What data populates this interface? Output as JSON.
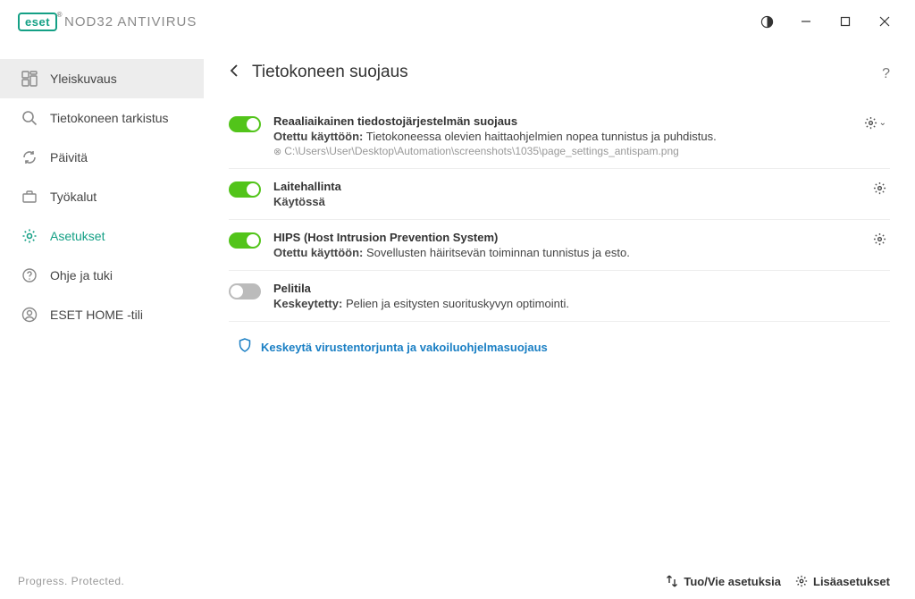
{
  "header": {
    "brand": "eset",
    "product": "NOD32 ANTIVIRUS"
  },
  "sidebar": {
    "items": [
      {
        "label": "Yleiskuvaus"
      },
      {
        "label": "Tietokoneen tarkistus"
      },
      {
        "label": "Päivitä"
      },
      {
        "label": "Työkalut"
      },
      {
        "label": "Asetukset"
      },
      {
        "label": "Ohje ja tuki"
      },
      {
        "label": "ESET HOME -tili"
      }
    ]
  },
  "page": {
    "title": "Tietokoneen suojaus"
  },
  "settings": [
    {
      "title": "Reaaliaikainen tiedostojärjestelmän suojaus",
      "status": "Otettu käyttöön:",
      "desc": "Tietokoneessa olevien haittaohjelmien nopea tunnistus ja puhdistus.",
      "path": "C:\\Users\\User\\Desktop\\Automation\\screenshots\\1035\\page_settings_antispam.png",
      "enabled": true,
      "gear_dropdown": true
    },
    {
      "title": "Laitehallinta",
      "status": "Käytössä",
      "desc": "",
      "enabled": true,
      "gear_dropdown": false
    },
    {
      "title": "HIPS (Host Intrusion Prevention System)",
      "status": "Otettu käyttöön:",
      "desc": "Sovellusten häiritsevän toiminnan tunnistus ja esto.",
      "enabled": true,
      "gear_dropdown": false
    },
    {
      "title": "Pelitila",
      "status": "Keskeytetty:",
      "desc": "Pelien ja esitysten suorituskyvyn optimointi.",
      "enabled": false,
      "no_gear": true
    }
  ],
  "pause_link": "Keskeytä virustentorjunta ja vakoiluohjelmasuojaus",
  "footer": {
    "tagline": "Progress. Protected.",
    "import_export": "Tuo/Vie asetuksia",
    "advanced": "Lisäasetukset"
  }
}
